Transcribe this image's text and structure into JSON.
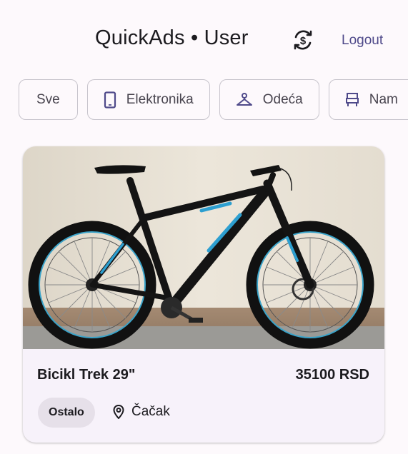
{
  "header": {
    "title": "QuickAds • User",
    "switch_icon": "currency-exchange-icon",
    "logout_label": "Logout"
  },
  "categories": [
    {
      "label": "Sve",
      "icon": ""
    },
    {
      "label": "Elektronika",
      "icon": "smartphone-icon"
    },
    {
      "label": "Odeća",
      "icon": "hanger-icon"
    },
    {
      "label": "Nam",
      "icon": "furniture-icon"
    }
  ],
  "listing": {
    "title": "Bicikl Trek 29\"",
    "price": "35100 RSD",
    "category": "Ostalo",
    "location": "Čačak",
    "location_icon": "location-pin-icon",
    "image": "mountain-bike-photo"
  },
  "colors": {
    "background": "#fdf9fc",
    "card": "#f7f2fa",
    "accent": "#4f4a8a",
    "chip_border": "#c7c4cc",
    "badge_bg": "#e6e0e9"
  }
}
